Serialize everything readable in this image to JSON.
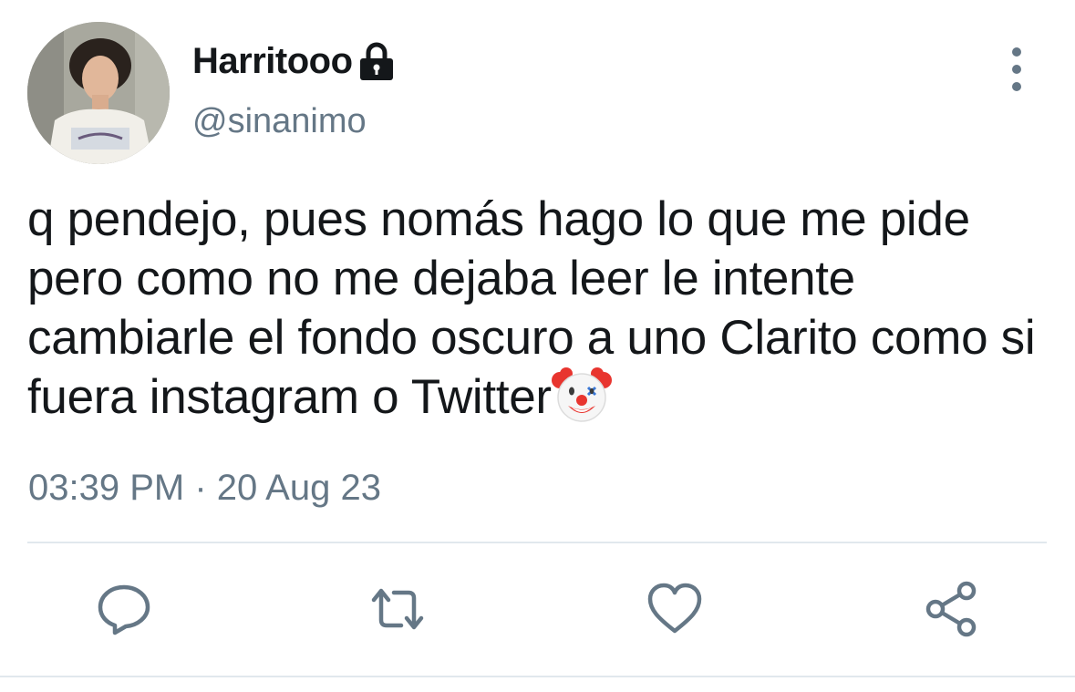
{
  "tweet": {
    "display_name": "Harritooo",
    "handle": "@sinanimo",
    "text": "q pendejo, pues nomás hago lo que me pide pero como no me dejaba leer le intente cambiarle el fondo oscuro a uno Clarito como si fuera instagram o Twitter",
    "emoji": "clown-face",
    "timestamp": "03:39 PM · 20 Aug 23",
    "protected": true
  },
  "actions": [
    {
      "name": "reply",
      "icon": "reply-icon"
    },
    {
      "name": "retweet",
      "icon": "retweet-icon"
    },
    {
      "name": "like",
      "icon": "heart-icon"
    },
    {
      "name": "share",
      "icon": "share-icon"
    }
  ],
  "colors": {
    "text_primary": "#14171a",
    "text_secondary": "#657786",
    "icon": "#657786",
    "divider": "#e1e8ed",
    "background": "#ffffff"
  }
}
